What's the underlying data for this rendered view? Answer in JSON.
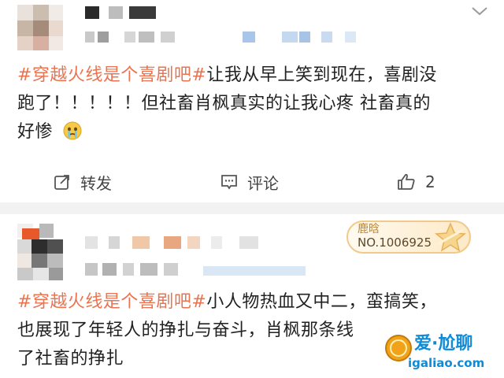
{
  "post1": {
    "hashtag": "#穿越火线是个喜剧吧#",
    "text_lines": [
      "让我从早上笑到现在，喜剧没",
      "跑了！！！！！但社畜肖枫真实的让我心疼 社畜真的",
      "好惨"
    ],
    "emoji_icon": "crying-face-icon",
    "actions": {
      "repost_label": "转发",
      "comment_label": "评论",
      "like_count": "2"
    }
  },
  "post2": {
    "badge": {
      "title": "鹿晗",
      "number": "NO.1006925",
      "icon": "star-icon"
    },
    "hashtag": "#穿越火线是个喜剧吧#",
    "text_lines": [
      "小人物热血又中二，蛮搞笑，",
      "也展现了年轻人的挣扎与奋斗，肖枫那条线",
      "了社畜的挣扎"
    ]
  },
  "watermark": {
    "line1": "爱·尬聊",
    "line2": "igaliao.com",
    "icon": "gold-coin-icon"
  },
  "colors": {
    "hashtag": "#eb7350",
    "badge_border": "#f1c98a",
    "watermark": "#0f8bd6"
  }
}
